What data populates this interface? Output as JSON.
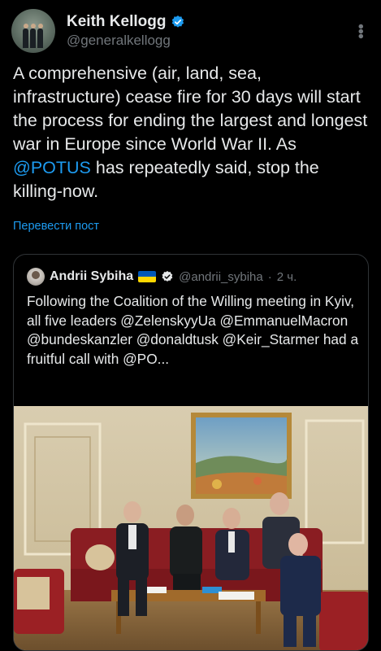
{
  "author": {
    "display_name": "Keith Kellogg",
    "handle": "@generalkellogg",
    "avatar_icon": "profile-photo-icon",
    "verified_icon": "verified-badge-icon"
  },
  "tweet": {
    "text_before": "A comprehensive (air, land, sea, infrastructure) cease fire for 30 days will start the process for ending the largest and longest war in Europe since World War II.  As ",
    "mention": "@POTUS",
    "text_after": " has repeatedly said, stop the killing-now.",
    "translate_label": "Перевести пост"
  },
  "quoted": {
    "display_name": "Andrii Sybiha",
    "handle": "@andrii_sybiha",
    "separator": "·",
    "time": "2 ч.",
    "text": "Following the Coalition of the Willing meeting in Kyiv, all five leaders @ZelenskyyUa @EmmanuelMacron @bundeskanzler @donaldtusk @Keir_Starmer had a fruitful call with @PO...",
    "flag_icon": "ukraine-flag-icon",
    "verified_icon": "verified-badge-icon"
  },
  "colors": {
    "background": "#000000",
    "text": "#e7e9ea",
    "secondary": "#71767b",
    "accent": "#1d9bf0",
    "border": "#2f3336"
  }
}
